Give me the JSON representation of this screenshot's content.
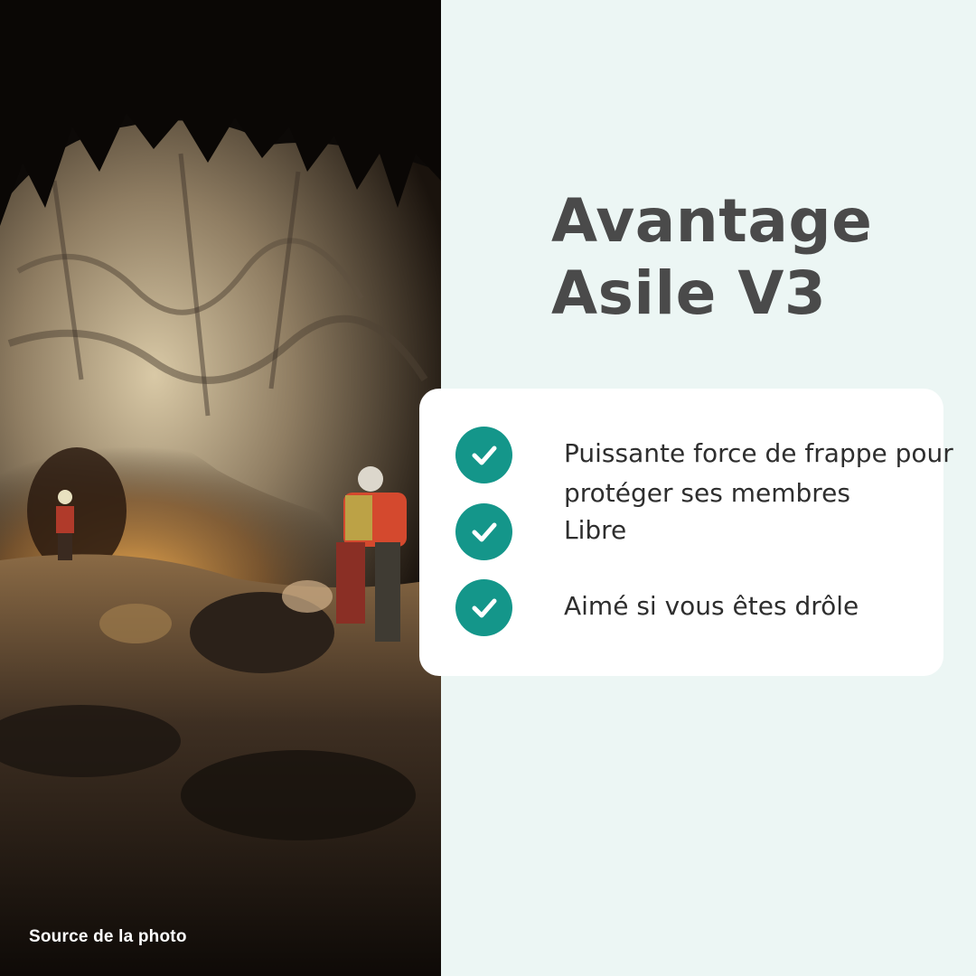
{
  "photo": {
    "description_icon": "cave-photo",
    "credit_label": "Source de la photo"
  },
  "title": {
    "line1": "Avantage",
    "line2": "Asile V3"
  },
  "benefits": [
    {
      "icon": "check-icon",
      "text": "Puissante force de frappe pour protéger ses membres"
    },
    {
      "icon": "check-icon",
      "text": "Libre"
    },
    {
      "icon": "check-icon",
      "text": "Aimé si vous êtes drôle"
    }
  ],
  "colors": {
    "background": "#ecf6f4",
    "accent": "#14968a",
    "title": "#4a4a4a",
    "card": "#ffffff"
  }
}
